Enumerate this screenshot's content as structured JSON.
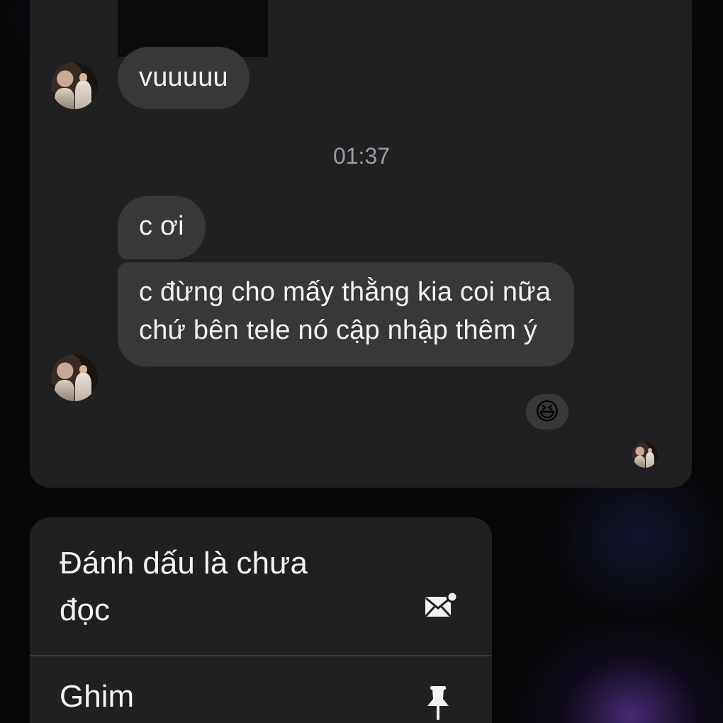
{
  "chat": {
    "messages": [
      {
        "text": "vuuuuu"
      },
      {
        "text": "c ơi"
      },
      {
        "text": "c đừng cho mấy thằng kia coi nữa chứ bên tele nó cập nhập thêm ý"
      }
    ],
    "timestamp": "01:37",
    "reaction": "😆"
  },
  "context_menu": {
    "items": [
      {
        "label": "Đánh dấu là chưa đọc",
        "icon": "mark-unread-envelope-icon"
      },
      {
        "label": "Ghim",
        "icon": "pin-icon"
      }
    ]
  },
  "colors": {
    "background": "#07070a",
    "card": "#202022",
    "bubble": "#38383b",
    "text": "#f2f2f4",
    "timestamp": "#9c9ca2"
  }
}
